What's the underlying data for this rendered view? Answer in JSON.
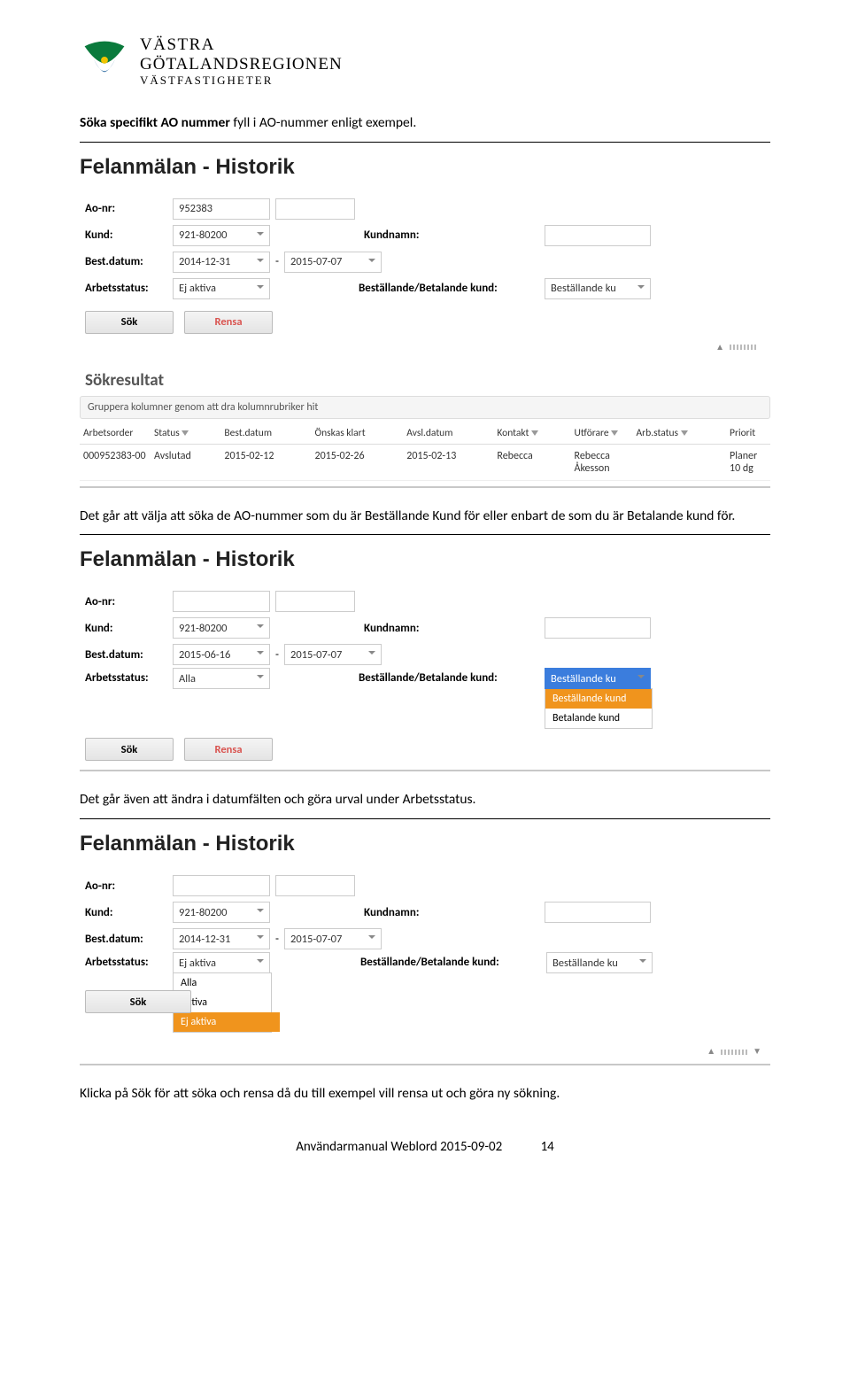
{
  "logo": {
    "l1": "VÄSTRA",
    "l2": "GÖTALANDSREGIONEN",
    "l3": "VÄSTFASTIGHETER"
  },
  "intro": {
    "bold": "Söka specifikt AO nummer",
    "rest": " fyll i AO-nummer enligt exempel."
  },
  "panelTitle": "Felanmälan - Historik",
  "labels": {
    "aonr": "Ao-nr:",
    "kund": "Kund:",
    "kundnamn": "Kundnamn:",
    "bestdatum": "Best.datum:",
    "arbetsstatus": "Arbetsstatus:",
    "bbkund": "Beställande/Betalande kund:"
  },
  "buttons": {
    "sok": "Sök",
    "rensa": "Rensa"
  },
  "shot1": {
    "aonr": "952383",
    "aonr2": "",
    "kund": "921-80200",
    "kundnamn": "",
    "date1": "2014-12-31",
    "date2": "2015-07-07",
    "status": "Ej aktiva",
    "bbkund": "Beställande ku"
  },
  "sokresultat": {
    "title": "Sökresultat",
    "groupBar": "Gruppera kolumner genom att dra kolumnrubriker hit",
    "headers": [
      "Arbetsorder",
      "Status",
      "Best.datum",
      "Önskas klart",
      "Avsl.datum",
      "Kontakt",
      "Utförare",
      "Arb.status",
      "Priorit"
    ],
    "row": {
      "arbetsorder": "000952383-00",
      "status": "Avslutad",
      "bestdatum": "2015-02-12",
      "onskas": "2015-02-26",
      "avsl": "2015-02-13",
      "kontakt": "Rebecca",
      "utforare": "Rebecca Åkesson",
      "arbstatus": "",
      "priorit": "Planer 10 dg"
    }
  },
  "para2": "Det går att välja att söka de AO-nummer som du är Beställande Kund för eller enbart de som du är Betalande kund för.",
  "shot2": {
    "aonr": "",
    "kund": "921-80200",
    "kundnamn": "",
    "date1": "2015-06-16",
    "date2": "2015-07-07",
    "status": "Alla",
    "bbkundSel": "Beställande ku",
    "dropdown": {
      "opt1": "Beställande kund",
      "opt2": "Betalande kund"
    }
  },
  "para3": "Det går även att ändra i datumfälten och göra urval under Arbetsstatus.",
  "shot3": {
    "aonr": "",
    "kund": "921-80200",
    "kundnamn": "",
    "date1": "2014-12-31",
    "date2": "2015-07-07",
    "status": "Ej aktiva",
    "bbkund": "Beställande ku",
    "dropdown": {
      "opt1": "Alla",
      "opt2": "Aktiva",
      "opt3": "Ej aktiva"
    }
  },
  "para4": "Klicka på Sök för att söka och rensa då du till exempel vill rensa ut och göra ny sökning.",
  "footer": {
    "text": "Användarmanual Weblord 2015-09-02",
    "page": "14"
  }
}
